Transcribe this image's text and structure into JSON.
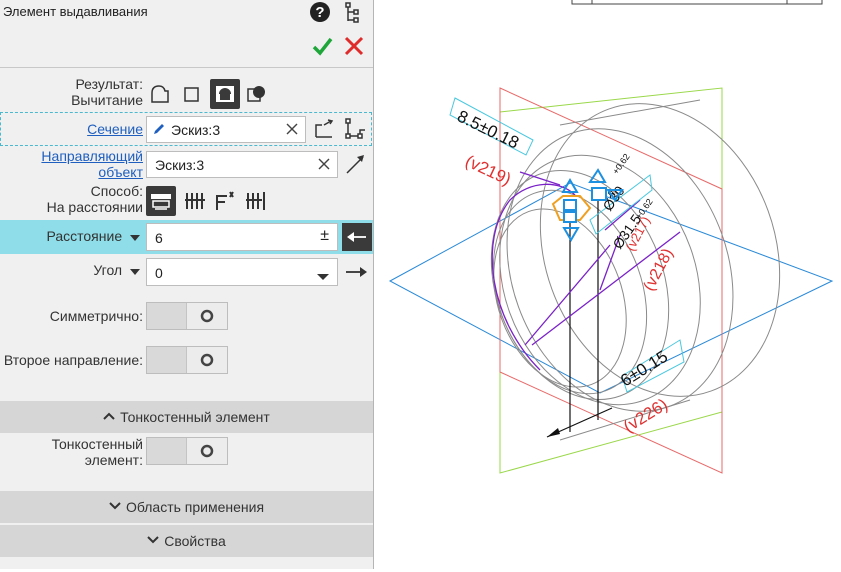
{
  "panel": {
    "title": "Элемент выдавливания",
    "result": {
      "label": "Результат:",
      "value": "Вычитание"
    },
    "section_field": {
      "label": "Сечение",
      "value": "Эскиз:3"
    },
    "guide_field": {
      "label_line1": "Направляющий",
      "label_line2": "объект",
      "value": "Эскиз:3"
    },
    "method": {
      "label": "Способ:",
      "value": "На расстоянии"
    },
    "distance": {
      "label": "Расстояние",
      "value": "6",
      "plus_minus": "±"
    },
    "angle": {
      "label": "Угол",
      "value": "0"
    },
    "symmetric": {
      "label": "Симметрично:"
    },
    "second_direction": {
      "label": "Второе направление:"
    },
    "thin_section": {
      "label": "Тонкостенный элемент"
    },
    "thin_element": {
      "label_line1": "Тонкостенный",
      "label_line2": "элемент:"
    },
    "apply_area": {
      "label": "Область применения"
    },
    "properties": {
      "label": "Свойства"
    }
  },
  "icons": [
    "help-icon",
    "tree-icon",
    "check-icon",
    "close-icon",
    "pencil-icon",
    "clear-icon",
    "arrow-left-icon",
    "arrow-right-icon",
    "dropdown-arrow-icon"
  ],
  "drawing": {
    "dim_top": "8.5±0.18",
    "dim_bottom": "6±0.15",
    "ref_219": "(v219)",
    "ref_218": "(v218)",
    "ref_226": "(v226)",
    "ref_217": "(v217)",
    "dia_small": "Ø30",
    "dia_large": "Ø31.5",
    "tol_small_upper": "+0.62",
    "tol_small_lower": "0",
    "tol_large_upper": "+0.62"
  },
  "colors": {
    "accent": "#8edde8",
    "check": "#1fa63a",
    "close": "#e02b2b",
    "link": "#1f5fbf",
    "dim_red": "#e03030",
    "purple": "#7a22c8",
    "handle_blue": "#1e90e0",
    "handle_orange": "#f0a020"
  }
}
